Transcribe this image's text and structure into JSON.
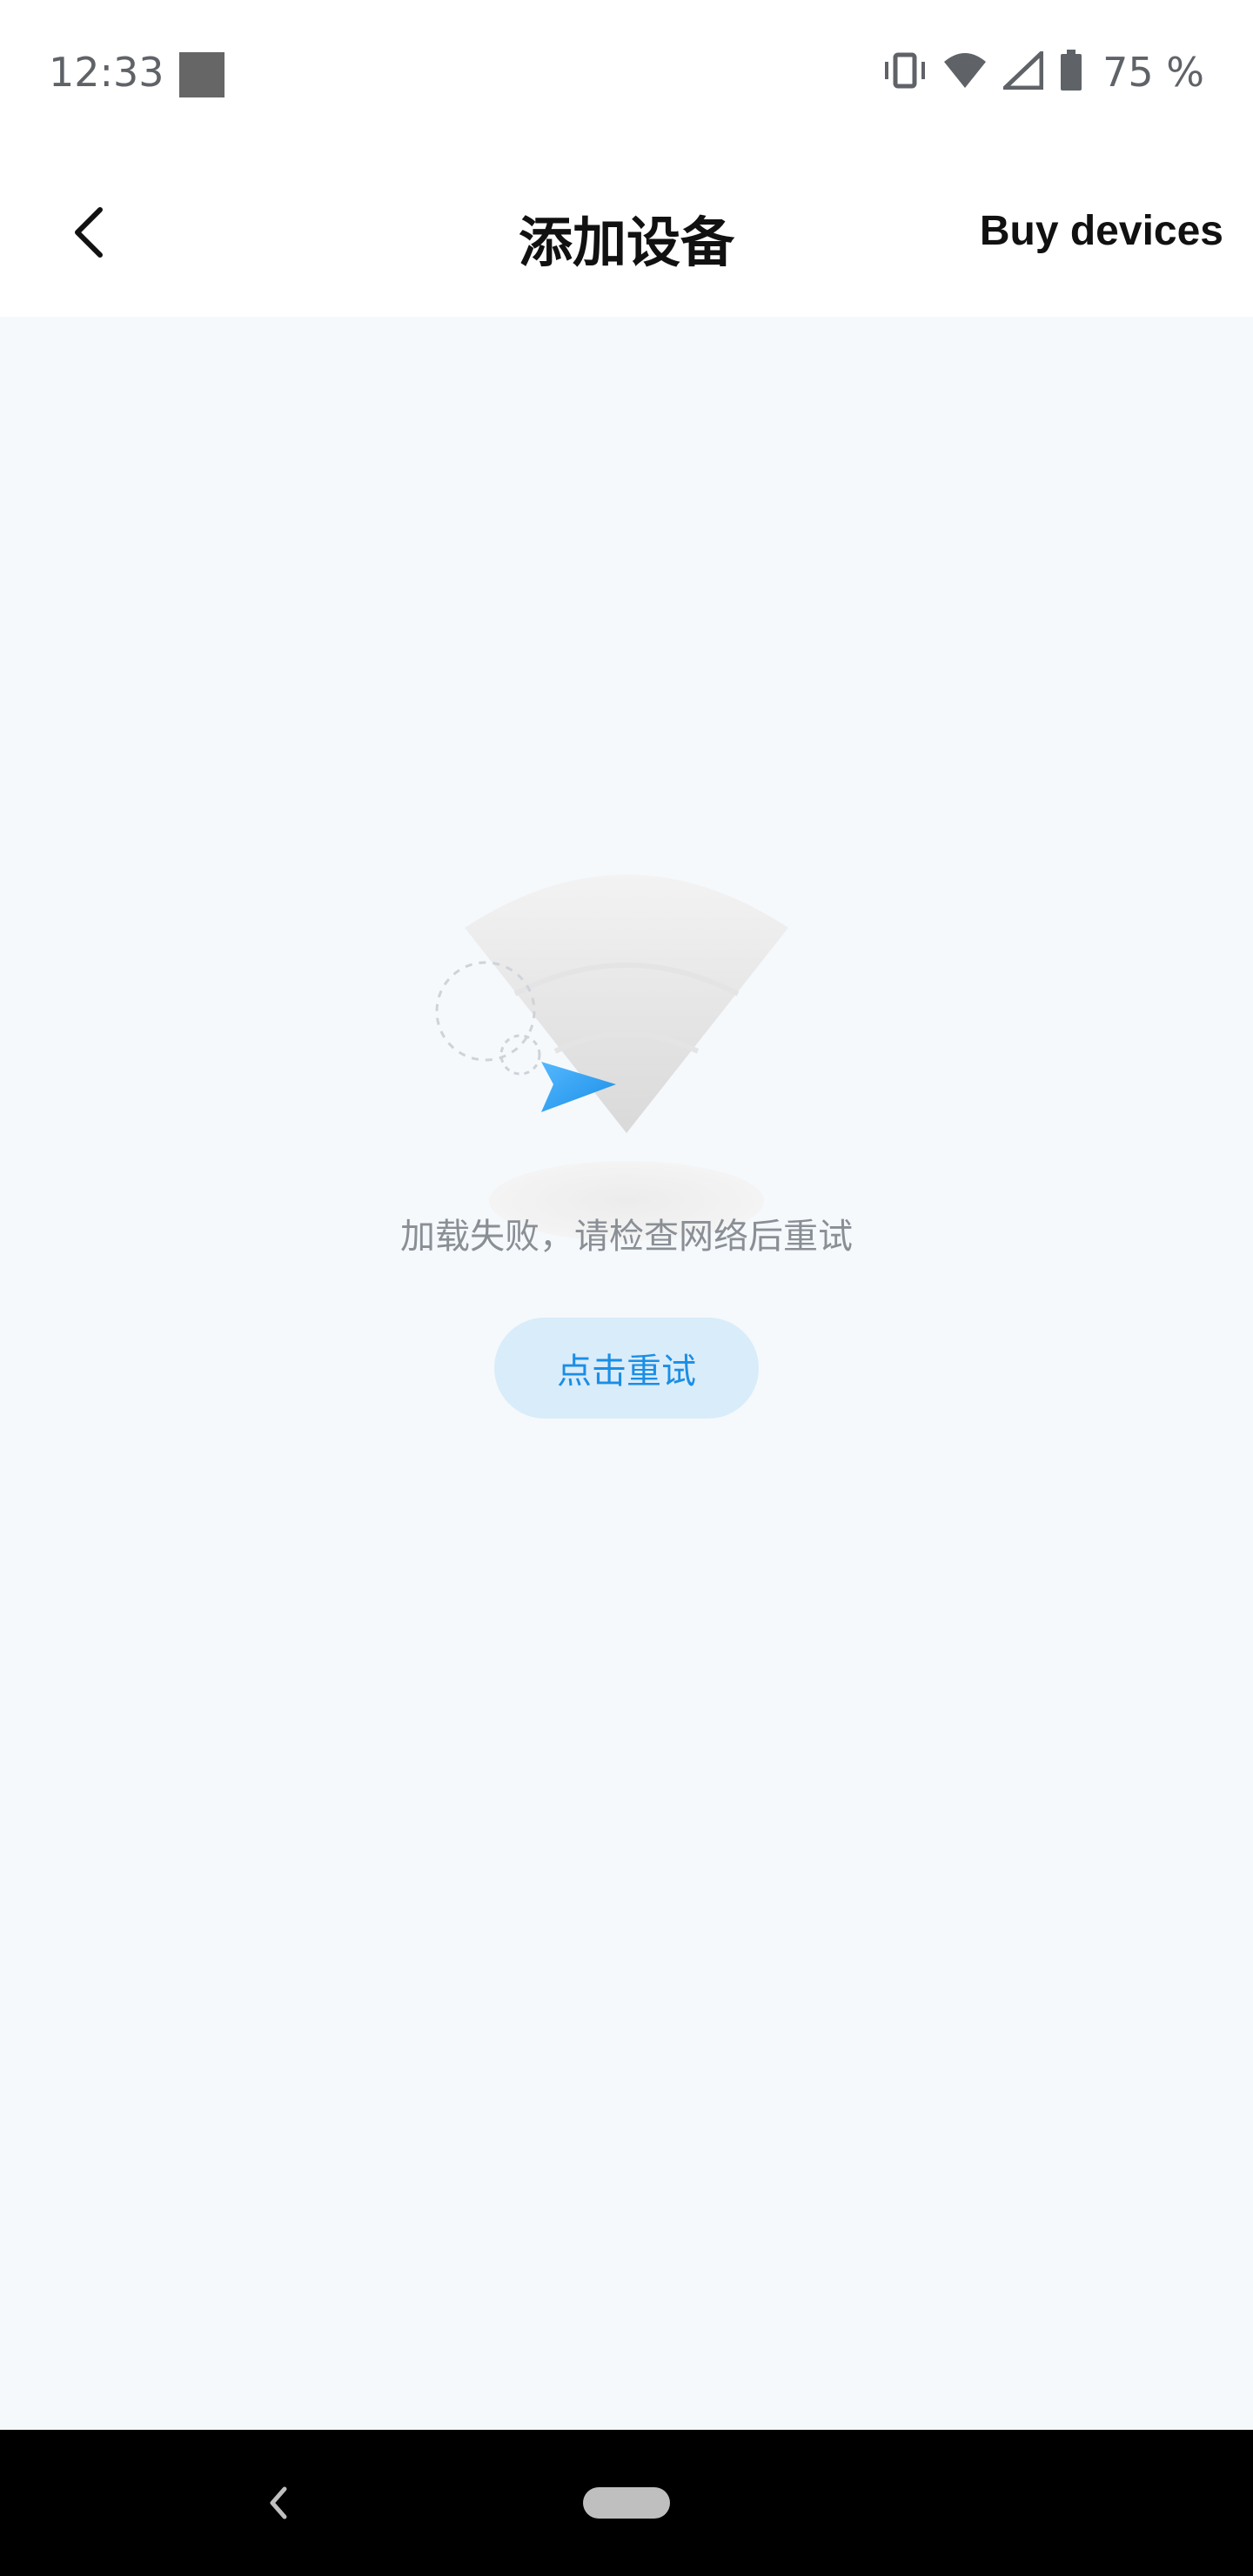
{
  "status_bar": {
    "time": "12:33",
    "battery_percent": "75 %",
    "icons": [
      "vibrate-icon",
      "wifi-icon",
      "signal-icon",
      "battery-icon"
    ]
  },
  "app_bar": {
    "title": "添加设备",
    "action_label": "Buy devices"
  },
  "content": {
    "error_message": "加载失败，请检查网络后重试",
    "retry_label": "点击重试"
  },
  "colors": {
    "accent": "#1a8ee6",
    "retry_bg": "#d9ecfa",
    "content_bg": "#f5f9fc"
  }
}
